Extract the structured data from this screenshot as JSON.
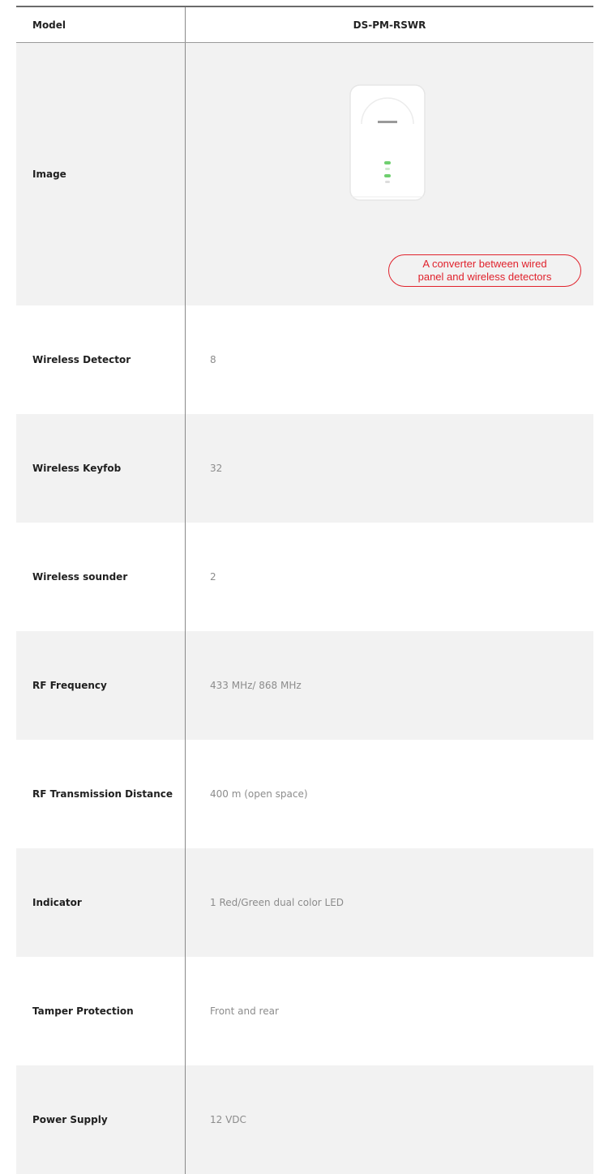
{
  "header": {
    "label": "Model",
    "value": "DS-PM-RSWR"
  },
  "image_row": {
    "label": "Image",
    "callout_line1": "A converter between wired",
    "callout_line2": "panel and wireless detectors",
    "callout_color": "#e0222c"
  },
  "rows": [
    {
      "label": "Wireless Detector",
      "value": "8"
    },
    {
      "label": "Wireless Keyfob",
      "value": "32"
    },
    {
      "label": "Wireless sounder",
      "value": "2"
    },
    {
      "label": "RF Frequency",
      "value": "433 MHz/ 868 MHz"
    },
    {
      "label": "RF Transmission Distance",
      "value": "400 m (open space)"
    },
    {
      "label": "Indicator",
      "value": "1 Red/Green dual color LED"
    },
    {
      "label": "Tamper Protection",
      "value": "Front and rear"
    },
    {
      "label": "Power Supply",
      "value": "12 VDC"
    }
  ],
  "colors": {
    "row_shade": "#f2f2f2",
    "led_green": "#6fcf6f"
  }
}
